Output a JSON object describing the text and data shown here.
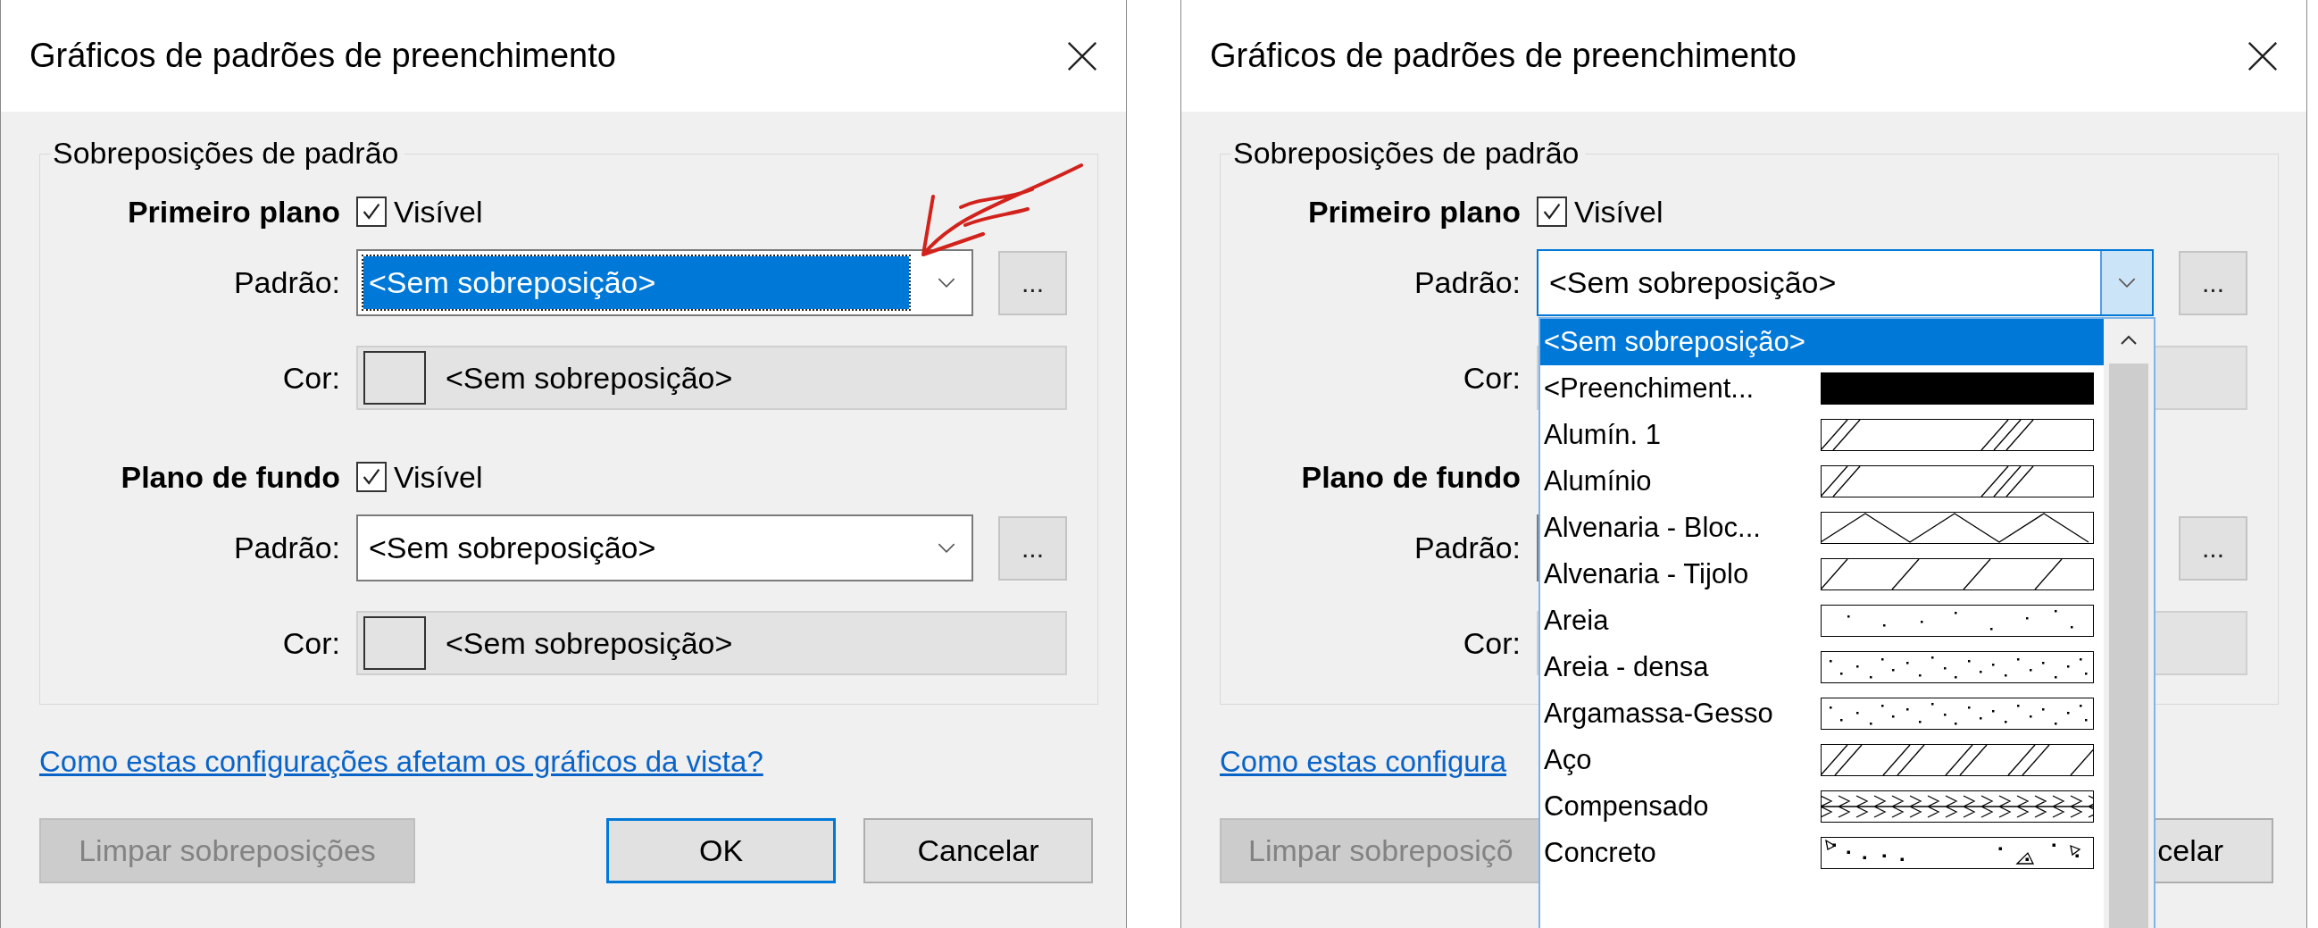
{
  "dialogs": [
    {
      "title": "Gráficos de padrões de preenchimento",
      "pointer_annotation": true,
      "group": {
        "title": "Sobreposições de padrão",
        "sections": [
          {
            "heading": "Primeiro plano",
            "visible": {
              "label": "Visível",
              "checked": true
            },
            "pattern": {
              "label": "Padrão:",
              "value": "<Sem sobreposição>",
              "focused": true,
              "open": false
            },
            "more_button": "...",
            "color": {
              "label": "Cor:",
              "value": "<Sem sobreposição>"
            }
          },
          {
            "heading": "Plano de fundo",
            "visible": {
              "label": "Visível",
              "checked": true
            },
            "pattern": {
              "label": "Padrão:",
              "value": "<Sem sobreposição>",
              "focused": false,
              "open": false
            },
            "more_button": "...",
            "color": {
              "label": "Cor:",
              "value": "<Sem sobreposição>"
            }
          }
        ]
      },
      "link": "Como estas configurações afetam os gráficos da vista?",
      "buttons": [
        {
          "kind": "clear",
          "label": "Limpar sobreposições",
          "disabled": true,
          "default": false
        },
        {
          "kind": "ok",
          "label": "OK",
          "disabled": false,
          "default": true
        },
        {
          "kind": "cancel",
          "label": "Cancelar",
          "disabled": false,
          "default": false
        }
      ]
    },
    {
      "title": "Gráficos de padrões de preenchimento",
      "pointer_annotation": false,
      "group": {
        "title": "Sobreposições de padrão",
        "sections": [
          {
            "heading": "Primeiro plano",
            "visible": {
              "label": "Visível",
              "checked": true
            },
            "pattern": {
              "label": "Padrão:",
              "value": "<Sem sobreposição>",
              "focused": false,
              "open": true
            },
            "more_button": "...",
            "color": {
              "label": "Cor:"
            }
          },
          {
            "heading": "Plano de fundo",
            "pattern": {
              "label": "Padrão:"
            },
            "more_button": "...",
            "color": {
              "label": "Cor:"
            }
          }
        ]
      },
      "link": "Como estas configura",
      "buttons": [
        {
          "kind": "clear",
          "label": "Limpar sobreposiçõ",
          "disabled": true,
          "default": false
        },
        {
          "kind": "cancel",
          "label": "celar",
          "disabled": false,
          "default": false
        }
      ],
      "dropdown": {
        "options": [
          {
            "label": "<Sem sobreposição>",
            "kind": "none",
            "selected": true
          },
          {
            "label": "<Preenchiment...",
            "kind": "solid",
            "selected": false
          },
          {
            "label": "Alumín. 1",
            "kind": "hatch-groups",
            "selected": false
          },
          {
            "label": "Alumínio",
            "kind": "hatch-groups",
            "selected": false
          },
          {
            "label": "Alvenaria - Bloc...",
            "kind": "zigzag",
            "selected": false
          },
          {
            "label": "Alvenaria - Tijolo",
            "kind": "hatch-wide",
            "selected": false
          },
          {
            "label": "Areia",
            "kind": "sand",
            "selected": false
          },
          {
            "label": "Areia - densa",
            "kind": "sand-dense",
            "selected": false
          },
          {
            "label": "Argamassa-Gesso",
            "kind": "sand-dense",
            "selected": false
          },
          {
            "label": "Aço",
            "kind": "hatch",
            "selected": false
          },
          {
            "label": "Compensado",
            "kind": "chevron",
            "selected": false
          },
          {
            "label": "Concreto",
            "kind": "concrete",
            "selected": false
          }
        ]
      }
    }
  ]
}
